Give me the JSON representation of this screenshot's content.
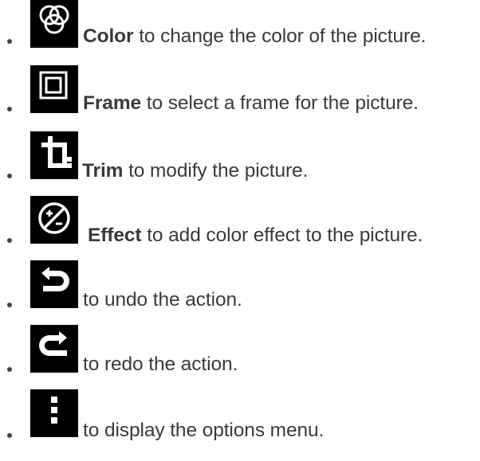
{
  "items": [
    {
      "icon": "color-circles-icon",
      "label": "Color",
      "text": "to change the color of the picture."
    },
    {
      "icon": "frame-icon",
      "label": "Frame",
      "text": "to select a frame for the picture."
    },
    {
      "icon": "crop-icon",
      "label": "Trim",
      "text": "to modify the picture."
    },
    {
      "icon": "exposure-plus-minus-icon",
      "label": "Effect",
      "text": "to add color effect to the picture."
    },
    {
      "icon": "undo-icon",
      "label": "",
      "text": "to undo the action."
    },
    {
      "icon": "redo-icon",
      "label": "",
      "text": "to redo the action."
    },
    {
      "icon": "overflow-menu-icon",
      "label": "",
      "text": "to display the options menu."
    }
  ]
}
